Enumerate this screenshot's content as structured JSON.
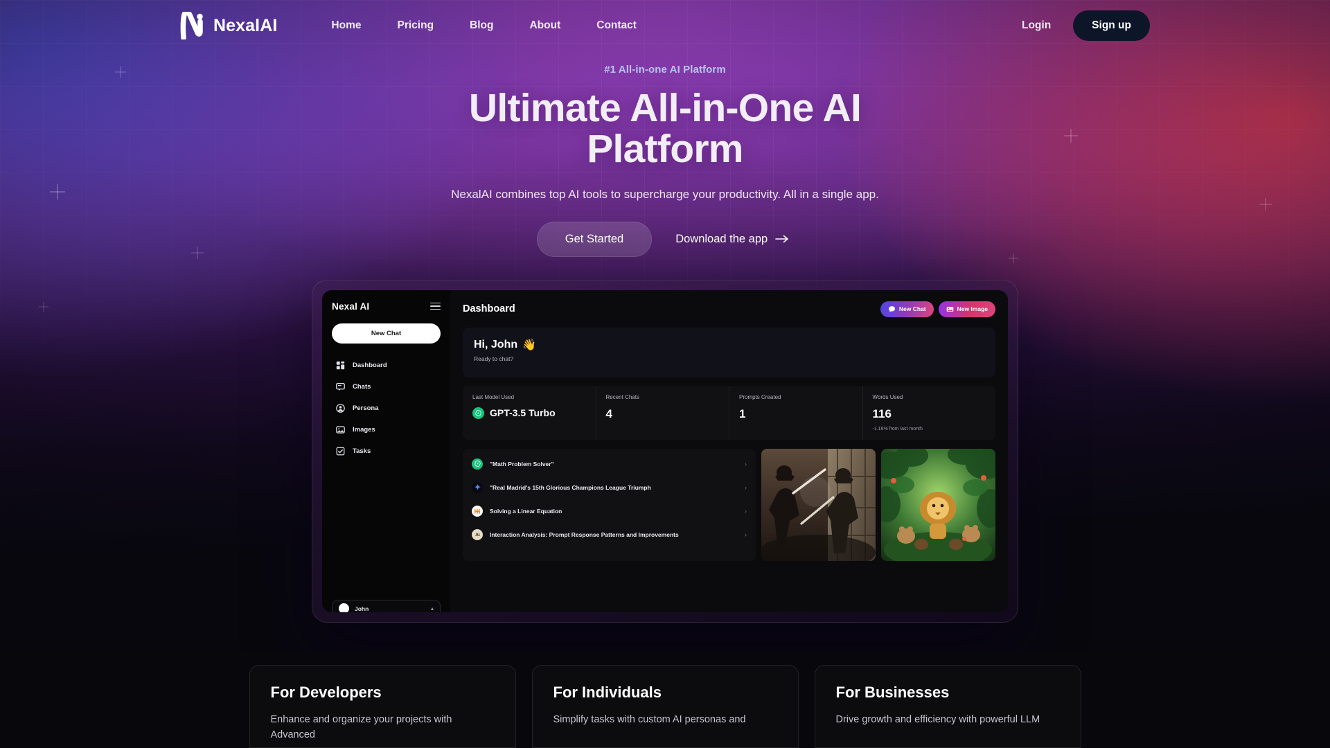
{
  "nav": {
    "brand": "NexalAI",
    "logo_icon": "nexal-n-logo",
    "links": [
      {
        "label": "Home"
      },
      {
        "label": "Pricing"
      },
      {
        "label": "Blog"
      },
      {
        "label": "About"
      },
      {
        "label": "Contact"
      }
    ],
    "login_label": "Login",
    "signup_label": "Sign up",
    "signup_bg": "#0d1529"
  },
  "hero": {
    "eyebrow": "#1 All-in-one AI Platform",
    "eyebrow_color": "#b7c4ee",
    "title": "Ultimate All-in-One AI Platform",
    "subtitle": "NexalAI combines top AI tools to supercharge your productivity. All in a single app.",
    "cta_primary": "Get Started",
    "cta_secondary": "Download the app",
    "cta_secondary_icon": "arrow-right-icon"
  },
  "app": {
    "sidebar": {
      "title": "Nexal AI",
      "menu_icon": "hamburger-icon",
      "new_chat_label": "New Chat",
      "items": [
        {
          "label": "Dashboard",
          "icon": "grid-dashboard-icon"
        },
        {
          "label": "Chats",
          "icon": "chat-bubble-icon"
        },
        {
          "label": "Persona",
          "icon": "user-circle-icon"
        },
        {
          "label": "Images",
          "icon": "image-icon"
        },
        {
          "label": "Tasks",
          "icon": "task-check-icon"
        }
      ],
      "user": {
        "name": "John",
        "avatar_icon": "user-avatar",
        "caret_icon": "chevron-up-icon"
      }
    },
    "header": {
      "title": "Dashboard",
      "actions": [
        {
          "label": "New Chat",
          "icon": "chat-plus-icon",
          "accent": "#4f46e5"
        },
        {
          "label": "New Image",
          "icon": "image-plus-icon",
          "accent": "#d6336c"
        }
      ]
    },
    "greeting": {
      "title": "Hi, John",
      "emoji": "👋",
      "subtitle": "Ready to chat?"
    },
    "stats": [
      {
        "label": "Last Model Used",
        "value": "GPT-3.5 Turbo",
        "icon": "openai-icon",
        "delta": ""
      },
      {
        "label": "Recent Chats",
        "value": "4",
        "icon": "",
        "delta": ""
      },
      {
        "label": "Prompts Created",
        "value": "1",
        "icon": "",
        "delta": ""
      },
      {
        "label": "Words Used",
        "value": "116",
        "icon": "",
        "delta": "-1.16% from last month"
      }
    ],
    "chats": [
      {
        "title": "\"Math Problem Solver\"",
        "icon": "openai-icon",
        "caret": "chevron-right-icon"
      },
      {
        "title": "\"Real Madrid's 15th Glorious Champions League Triumph",
        "icon": "gemini-icon",
        "caret": "chevron-right-icon"
      },
      {
        "title": "Solving a Linear Equation",
        "icon": "mistral-icon",
        "caret": "chevron-right-icon"
      },
      {
        "title": "Interaction Analysis: Prompt Response Patterns and Improvements",
        "icon": "anthropic-icon",
        "caret": "chevron-right-icon"
      }
    ],
    "images": [
      {
        "alt": "samurai-battle-illustration"
      },
      {
        "alt": "lion-and-animals-jungle-illustration"
      }
    ]
  },
  "features": [
    {
      "title": "For Developers",
      "desc": "Enhance and organize your projects with Advanced"
    },
    {
      "title": "For Individuals",
      "desc": "Simplify tasks with custom AI personas and"
    },
    {
      "title": "For Businesses",
      "desc": "Drive growth and efficiency with powerful LLM"
    }
  ]
}
